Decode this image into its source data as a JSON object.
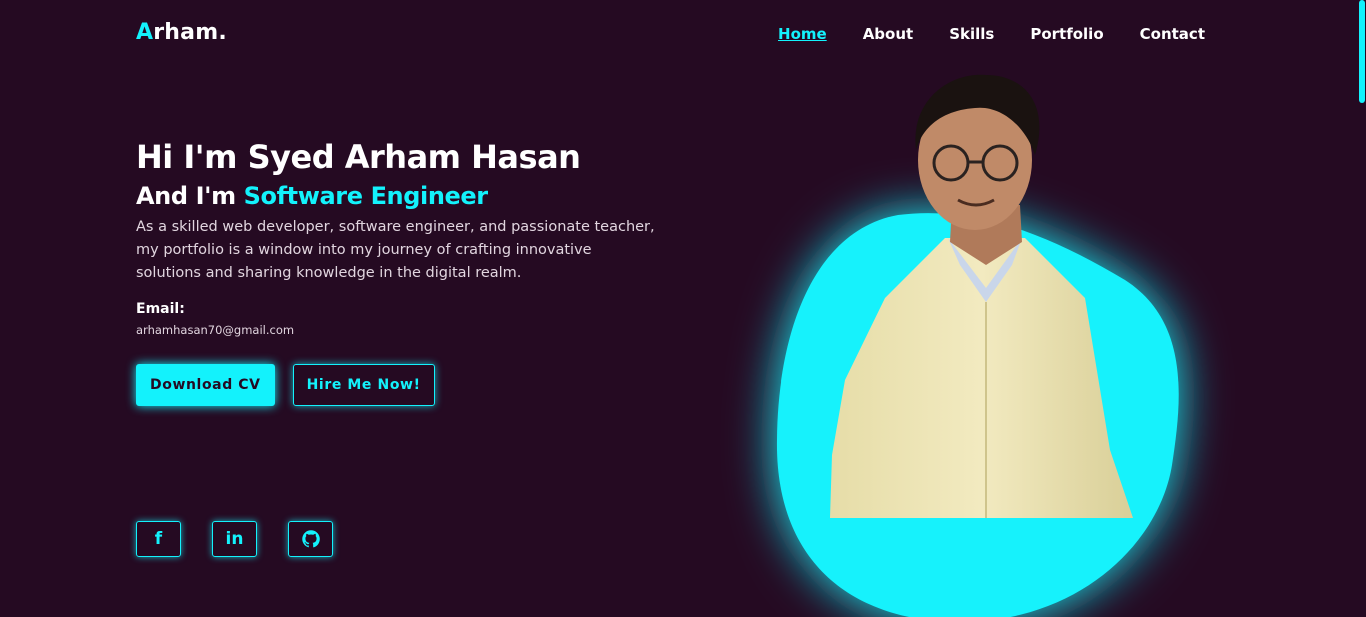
{
  "brand": {
    "first_letter": "A",
    "rest": "rham."
  },
  "nav": {
    "items": [
      {
        "label": "Home",
        "active": true
      },
      {
        "label": "About"
      },
      {
        "label": "Skills"
      },
      {
        "label": "Portfolio"
      },
      {
        "label": "Contact"
      }
    ]
  },
  "hero": {
    "greeting": "Hi I'm Syed Arham Hasan",
    "role_prefix": "And I'm ",
    "role": "Software Engineer",
    "description": "As a skilled web developer, software engineer, and passionate teacher, my portfolio is a window into my journey of crafting innovative solutions and sharing knowledge in the digital realm.",
    "email_label": "Email:",
    "email": "arhamhasan70@gmail.com"
  },
  "buttons": {
    "download": "Download CV",
    "hire": "Hire Me Now!"
  },
  "social": [
    {
      "icon": "facebook-icon",
      "glyph": "f"
    },
    {
      "icon": "linkedin-icon",
      "glyph": "in"
    },
    {
      "icon": "github-icon"
    }
  ],
  "colors": {
    "accent": "#13f2fc",
    "background": "#250a22"
  }
}
